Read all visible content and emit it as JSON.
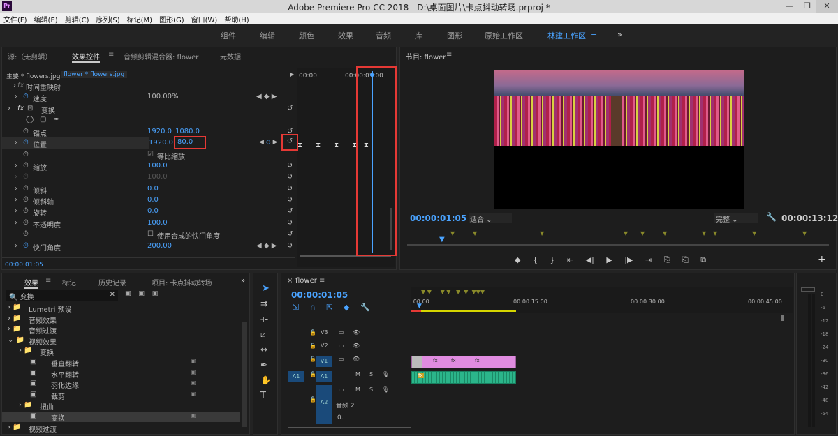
{
  "app": {
    "title": "Adobe Premiere Pro CC 2018 - D:\\桌面图片\\卡点抖动转场.prproj *",
    "logo": "Pr"
  },
  "menu": [
    "文件(F)",
    "编辑(E)",
    "剪辑(C)",
    "序列(S)",
    "标记(M)",
    "图形(G)",
    "窗口(W)",
    "帮助(H)"
  ],
  "workspaces": [
    "组件",
    "编辑",
    "颜色",
    "效果",
    "音频",
    "库",
    "图形",
    "原始工作区",
    "林建工作区"
  ],
  "active_workspace": "林建工作区",
  "effect_controls": {
    "tabs": [
      "源:（无剪辑）",
      "效果控件",
      "音频剪辑混合器: flower",
      "元数据"
    ],
    "master": "主要 * flowers.jpg",
    "clip": "flower * flowers.jpg",
    "time_start": "00:00",
    "time_end": "00:00:01:00",
    "time_remap": "时间重映射",
    "speed": {
      "label": "速度",
      "value": "100.00%"
    },
    "transform": "变换",
    "anchor": {
      "label": "锚点",
      "x": "1920.0",
      "y": "1080.0"
    },
    "position": {
      "label": "位置",
      "x": "1920.0",
      "y": "80.0"
    },
    "uniform": "等比缩放",
    "scale": {
      "label": "缩放",
      "value": "100.0"
    },
    "scale_w": "100.0",
    "skew": {
      "label": "倾斜",
      "value": "0.0"
    },
    "skew_axis": {
      "label": "倾斜轴",
      "value": "0.0"
    },
    "rotation": {
      "label": "旋转",
      "value": "0.0"
    },
    "opacity": {
      "label": "不透明度",
      "value": "100.0"
    },
    "comp_shutter": "使用合成的快门角度",
    "shutter": {
      "label": "快门角度",
      "value": "200.00"
    },
    "timecode": "00:00:01:05"
  },
  "program": {
    "title": "节目: flower",
    "timecode": "00:00:01:05",
    "fit": "适合",
    "quality": "完整",
    "duration": "00:00:13:12"
  },
  "effects_panel": {
    "tabs": [
      "效果",
      "标记",
      "历史记录",
      "项目: 卡点抖动转场"
    ],
    "search": "变换",
    "tree": [
      {
        "label": "Lumetri 预设",
        "level": 0
      },
      {
        "label": "音频效果",
        "level": 0
      },
      {
        "label": "音频过渡",
        "level": 0
      },
      {
        "label": "视频效果",
        "level": 0
      },
      {
        "label": "变换",
        "level": 1
      },
      {
        "label": "垂直翻转",
        "level": 2
      },
      {
        "label": "水平翻转",
        "level": 2
      },
      {
        "label": "羽化边缘",
        "level": 2
      },
      {
        "label": "裁剪",
        "level": 2
      },
      {
        "label": "扭曲",
        "level": 1
      },
      {
        "label": "变换",
        "level": 2,
        "selected": true
      },
      {
        "label": "视频过渡",
        "level": 0
      }
    ]
  },
  "timeline": {
    "tab": "flower",
    "timecode": "00:00:01:05",
    "ruler": [
      ":00:00",
      "00:00:15:00",
      "00:00:30:00",
      "00:00:45:00"
    ],
    "tracks": [
      "V3",
      "V2",
      "V1",
      "A1",
      "A2"
    ],
    "src_v": "V1",
    "src_a": "A1",
    "a2_name": "音频 2",
    "a2_vol": "0."
  },
  "meter": [
    "0",
    "-6",
    "-12",
    "-18",
    "-24",
    "-30",
    "-36",
    "-42",
    "-48",
    "-54"
  ],
  "colors": {
    "accent": "#4aa3ff",
    "red": "#e53935",
    "clip": "#e08ce0",
    "audio": "#2bb58a"
  }
}
